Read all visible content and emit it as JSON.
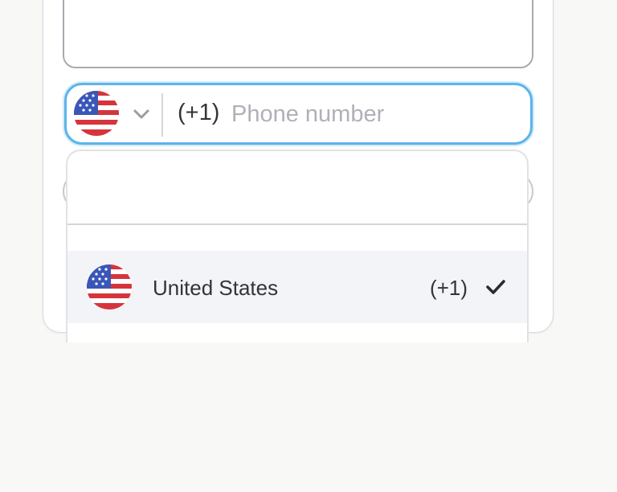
{
  "phone": {
    "country_icon": "us-flag-icon",
    "dial_prefix": "(+1)",
    "value": "",
    "placeholder": "Phone number"
  },
  "dropdown": {
    "search_value": "",
    "options": [
      {
        "name": "United States",
        "code": "(+1)",
        "selected": true,
        "icon": "us-flag-icon"
      }
    ]
  },
  "colors": {
    "focus_border": "#5cb3ea",
    "selected_row_bg": "#f3f4f7",
    "flag_red": "#d6343c",
    "flag_blue": "#3a57b8"
  }
}
